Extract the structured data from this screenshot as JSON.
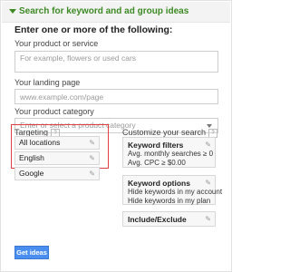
{
  "header": {
    "title": "Search for keyword and ad group ideas",
    "icon": "triangle-down-icon"
  },
  "form": {
    "section_title": "Enter one or more of the following:",
    "product_label": "Your product or service",
    "product_placeholder": "For example, flowers or used cars",
    "landing_label": "Your landing page",
    "landing_placeholder": "www.example.com/page",
    "category_label": "Your product category",
    "category_placeholder": "Enter or select a product category"
  },
  "targeting": {
    "label": "Targeting",
    "help": "?",
    "items": [
      "All locations",
      "English",
      "Google"
    ]
  },
  "customize": {
    "label": "Customize your search",
    "help": "?",
    "keyword_filters": {
      "title": "Keyword filters",
      "line1": "Avg. monthly searches ≥ 0",
      "line2": "Avg. CPC ≥ $0.00"
    },
    "keyword_options": {
      "title": "Keyword options",
      "line1": "Hide keywords in my account",
      "line2": "Hide keywords in my plan"
    },
    "include_exclude": {
      "title": "Include/Exclude"
    }
  },
  "actions": {
    "get_ideas": "Get ideas"
  },
  "colors": {
    "accent_green": "#3d8a24",
    "button_blue": "#4a8ef0",
    "highlight_red": "#e04040"
  }
}
